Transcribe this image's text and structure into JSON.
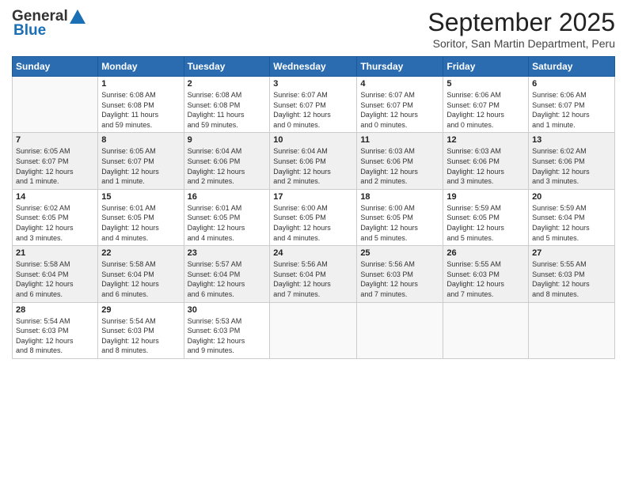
{
  "header": {
    "logo_line1": "General",
    "logo_line2": "Blue",
    "title": "September 2025",
    "location": "Soritor, San Martin Department, Peru"
  },
  "weekdays": [
    "Sunday",
    "Monday",
    "Tuesday",
    "Wednesday",
    "Thursday",
    "Friday",
    "Saturday"
  ],
  "weeks": [
    [
      {
        "day": "",
        "info": ""
      },
      {
        "day": "1",
        "info": "Sunrise: 6:08 AM\nSunset: 6:08 PM\nDaylight: 11 hours\nand 59 minutes."
      },
      {
        "day": "2",
        "info": "Sunrise: 6:08 AM\nSunset: 6:08 PM\nDaylight: 11 hours\nand 59 minutes."
      },
      {
        "day": "3",
        "info": "Sunrise: 6:07 AM\nSunset: 6:07 PM\nDaylight: 12 hours\nand 0 minutes."
      },
      {
        "day": "4",
        "info": "Sunrise: 6:07 AM\nSunset: 6:07 PM\nDaylight: 12 hours\nand 0 minutes."
      },
      {
        "day": "5",
        "info": "Sunrise: 6:06 AM\nSunset: 6:07 PM\nDaylight: 12 hours\nand 0 minutes."
      },
      {
        "day": "6",
        "info": "Sunrise: 6:06 AM\nSunset: 6:07 PM\nDaylight: 12 hours\nand 1 minute."
      }
    ],
    [
      {
        "day": "7",
        "info": "Sunrise: 6:05 AM\nSunset: 6:07 PM\nDaylight: 12 hours\nand 1 minute."
      },
      {
        "day": "8",
        "info": "Sunrise: 6:05 AM\nSunset: 6:07 PM\nDaylight: 12 hours\nand 1 minute."
      },
      {
        "day": "9",
        "info": "Sunrise: 6:04 AM\nSunset: 6:06 PM\nDaylight: 12 hours\nand 2 minutes."
      },
      {
        "day": "10",
        "info": "Sunrise: 6:04 AM\nSunset: 6:06 PM\nDaylight: 12 hours\nand 2 minutes."
      },
      {
        "day": "11",
        "info": "Sunrise: 6:03 AM\nSunset: 6:06 PM\nDaylight: 12 hours\nand 2 minutes."
      },
      {
        "day": "12",
        "info": "Sunrise: 6:03 AM\nSunset: 6:06 PM\nDaylight: 12 hours\nand 3 minutes."
      },
      {
        "day": "13",
        "info": "Sunrise: 6:02 AM\nSunset: 6:06 PM\nDaylight: 12 hours\nand 3 minutes."
      }
    ],
    [
      {
        "day": "14",
        "info": "Sunrise: 6:02 AM\nSunset: 6:05 PM\nDaylight: 12 hours\nand 3 minutes."
      },
      {
        "day": "15",
        "info": "Sunrise: 6:01 AM\nSunset: 6:05 PM\nDaylight: 12 hours\nand 4 minutes."
      },
      {
        "day": "16",
        "info": "Sunrise: 6:01 AM\nSunset: 6:05 PM\nDaylight: 12 hours\nand 4 minutes."
      },
      {
        "day": "17",
        "info": "Sunrise: 6:00 AM\nSunset: 6:05 PM\nDaylight: 12 hours\nand 4 minutes."
      },
      {
        "day": "18",
        "info": "Sunrise: 6:00 AM\nSunset: 6:05 PM\nDaylight: 12 hours\nand 5 minutes."
      },
      {
        "day": "19",
        "info": "Sunrise: 5:59 AM\nSunset: 6:05 PM\nDaylight: 12 hours\nand 5 minutes."
      },
      {
        "day": "20",
        "info": "Sunrise: 5:59 AM\nSunset: 6:04 PM\nDaylight: 12 hours\nand 5 minutes."
      }
    ],
    [
      {
        "day": "21",
        "info": "Sunrise: 5:58 AM\nSunset: 6:04 PM\nDaylight: 12 hours\nand 6 minutes."
      },
      {
        "day": "22",
        "info": "Sunrise: 5:58 AM\nSunset: 6:04 PM\nDaylight: 12 hours\nand 6 minutes."
      },
      {
        "day": "23",
        "info": "Sunrise: 5:57 AM\nSunset: 6:04 PM\nDaylight: 12 hours\nand 6 minutes."
      },
      {
        "day": "24",
        "info": "Sunrise: 5:56 AM\nSunset: 6:04 PM\nDaylight: 12 hours\nand 7 minutes."
      },
      {
        "day": "25",
        "info": "Sunrise: 5:56 AM\nSunset: 6:03 PM\nDaylight: 12 hours\nand 7 minutes."
      },
      {
        "day": "26",
        "info": "Sunrise: 5:55 AM\nSunset: 6:03 PM\nDaylight: 12 hours\nand 7 minutes."
      },
      {
        "day": "27",
        "info": "Sunrise: 5:55 AM\nSunset: 6:03 PM\nDaylight: 12 hours\nand 8 minutes."
      }
    ],
    [
      {
        "day": "28",
        "info": "Sunrise: 5:54 AM\nSunset: 6:03 PM\nDaylight: 12 hours\nand 8 minutes."
      },
      {
        "day": "29",
        "info": "Sunrise: 5:54 AM\nSunset: 6:03 PM\nDaylight: 12 hours\nand 8 minutes."
      },
      {
        "day": "30",
        "info": "Sunrise: 5:53 AM\nSunset: 6:03 PM\nDaylight: 12 hours\nand 9 minutes."
      },
      {
        "day": "",
        "info": ""
      },
      {
        "day": "",
        "info": ""
      },
      {
        "day": "",
        "info": ""
      },
      {
        "day": "",
        "info": ""
      }
    ]
  ]
}
